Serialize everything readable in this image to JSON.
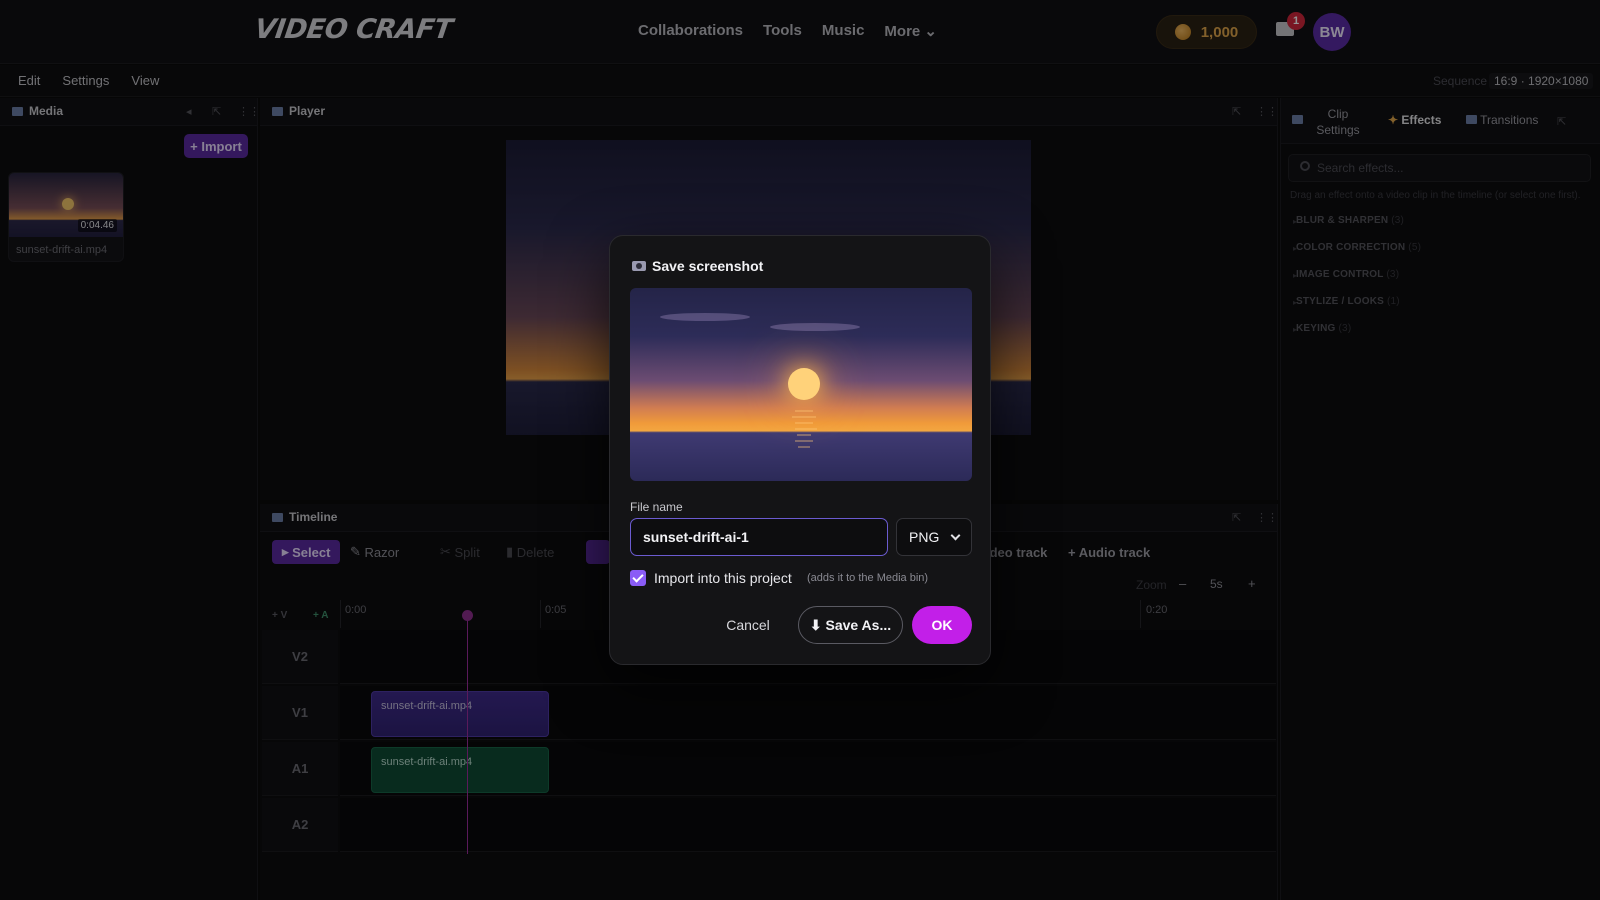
{
  "app": {
    "logo": "Video Craft"
  },
  "nav": {
    "links": [
      "Collaborations",
      "Tools",
      "Music",
      "More ⌄"
    ],
    "coins": "1,000",
    "notifications": "1",
    "avatar": "BW"
  },
  "menu": {
    "items": [
      "Edit",
      "Settings",
      "View"
    ],
    "sequence_label": "Sequence",
    "sequence_value": "16:9 · 1920×1080"
  },
  "media": {
    "tab": "Media",
    "import": "+ Import",
    "item": {
      "duration": "0:04.46",
      "name": "sunset-drift-ai.mp4"
    }
  },
  "player": {
    "tab": "Player"
  },
  "right": {
    "tabs": [
      "Clip Settings",
      "Effects",
      "Transitions"
    ],
    "search_placeholder": "Search effects...",
    "help": "Drag an effect onto a video clip in the timeline (or select one first).",
    "categories": [
      {
        "name": "BLUR & SHARPEN",
        "count": "(3)"
      },
      {
        "name": "COLOR CORRECTION",
        "count": "(5)"
      },
      {
        "name": "IMAGE CONTROL",
        "count": "(3)"
      },
      {
        "name": "STYLIZE / LOOKS",
        "count": "(1)"
      },
      {
        "name": "KEYING",
        "count": "(3)"
      }
    ]
  },
  "timeline": {
    "tab": "Timeline",
    "tools": [
      "Select",
      "Razor",
      "Split",
      "Delete"
    ],
    "add_video": "ideo track",
    "add_audio": "+ Audio track",
    "zoom_label": "Zoom",
    "zoom_minus": "–",
    "zoom_value": "5s",
    "zoom_plus": "+",
    "add_v": "+ V",
    "add_a": "+ A",
    "ticks": [
      "0:00",
      "0:05",
      "0:20"
    ],
    "tracks": [
      "V2",
      "V1",
      "A1",
      "A2"
    ],
    "clip_name": "sunset-drift-ai.mp4"
  },
  "dialog": {
    "title": "Save screenshot",
    "file_label": "File name",
    "file_value": "sunset-drift-ai-1",
    "format": "PNG",
    "import_label": "Import into this project",
    "import_hint": "(adds it to the Media bin)",
    "import_checked": true,
    "cancel": "Cancel",
    "save_as": "⬇ Save As...",
    "ok": "OK"
  },
  "colors": {
    "accent": "#c21fe8",
    "purple": "#5b2aa0",
    "coin": "#e0a64a"
  }
}
